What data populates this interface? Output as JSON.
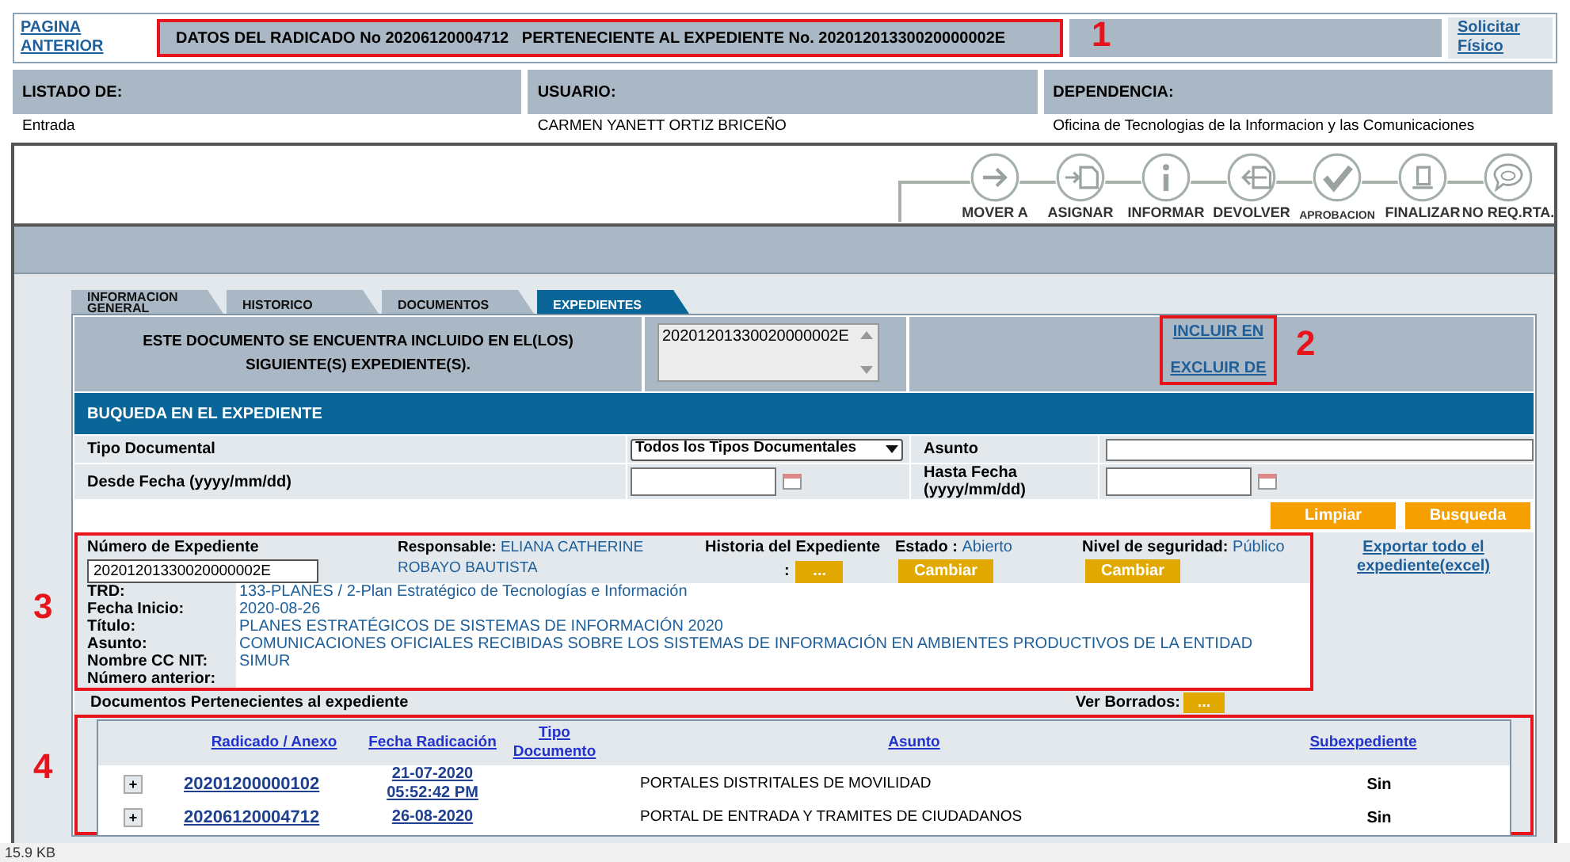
{
  "header": {
    "back_link": "PAGINA ANTERIOR",
    "title": "DATOS DEL RADICADO No 20206120004712   PERTENECIENTE AL EXPEDIENTE No. 20201201330020000002E",
    "request_link": "Solicitar Físico"
  },
  "info_columns": [
    {
      "heading": "LISTADO DE:",
      "value": "Entrada"
    },
    {
      "heading": "USUARIO:",
      "value": "CARMEN YANETT ORTIZ BRICEÑO"
    },
    {
      "heading": "DEPENDENCIA:",
      "value": "Oficina de Tecnologias de la Informacion y las Comunicaciones"
    }
  ],
  "actions": [
    {
      "kind": "move",
      "label": "MOVER A"
    },
    {
      "kind": "assign",
      "label": "ASIGNAR"
    },
    {
      "kind": "inform",
      "label": "INFORMAR"
    },
    {
      "kind": "return",
      "label": "DEVOLVER"
    },
    {
      "kind": "approve",
      "label": "APROBACION"
    },
    {
      "kind": "finalize",
      "label": "FINALIZAR"
    },
    {
      "kind": "noreply",
      "label": "NO REQ.RTA."
    }
  ],
  "tabs": [
    {
      "label": "INFORMACION GENERAL",
      "selected": false
    },
    {
      "label": "HISTORICO",
      "selected": false
    },
    {
      "label": "DOCUMENTOS",
      "selected": false
    },
    {
      "label": "EXPEDIENTES",
      "selected": true
    }
  ],
  "included": {
    "text": "ESTE DOCUMENTO SE ENCUENTRA INCLUIDO EN EL(LOS) SIGUIENTE(S) EXPEDIENTE(S).",
    "list": [
      "20201201330020000002E"
    ],
    "links": [
      "INCLUIR EN",
      "EXCLUIR DE"
    ]
  },
  "search": {
    "title": "BUQUEDA EN EL EXPEDIENTE",
    "type_label": "Tipo Documental",
    "type_value": "Todos los Tipos Documentales",
    "subject_label": "Asunto",
    "from_label": "Desde Fecha (yyyy/mm/dd)",
    "to_label": "Hasta Fecha (yyyy/mm/dd)",
    "buttons": [
      "Limpiar",
      "Busqueda"
    ]
  },
  "expediente": {
    "number_label": "Número de Expediente",
    "number_value": "20201201330020000002E",
    "responsible_label": "Responsable:",
    "responsible": "ELIANA CATHERINE ROBAYO BAUTISTA",
    "history_label": "Historia del Expediente",
    "history_colon": ":",
    "history_button": "...",
    "state_label": "Estado :",
    "state": "Abierto",
    "state_button": "Cambiar",
    "security_label": "Nivel de seguridad:",
    "security": "Público",
    "security_button": "Cambiar",
    "export_link": "Exportar todo el expediente(excel)",
    "details": [
      {
        "label": "TRD:",
        "value": "133-PLANES / 2-Plan Estratégico de Tecnologías e Información"
      },
      {
        "label": "Fecha Inicio:",
        "value": "2020-08-26"
      },
      {
        "label": "Título:",
        "value": "PLANES ESTRATÉGICOS DE SISTEMAS DE INFORMACIÓN 2020"
      },
      {
        "label": "Asunto:",
        "value": "COMUNICACIONES OFICIALES RECIBIDAS SOBRE LOS SISTEMAS DE INFORMACIÓN EN AMBIENTES PRODUCTIVOS DE LA ENTIDAD"
      },
      {
        "label": "Nombre CC NIT:",
        "value": "SIMUR"
      },
      {
        "label": "Número anterior:"
      }
    ]
  },
  "documents": {
    "title": "Documentos Pertenecientes al expediente",
    "deleted_label": "Ver Borrados:",
    "deleted_button": "...",
    "columns": [
      "Radicado / Anexo",
      "Fecha Radicación",
      "Tipo Documento",
      "Asunto",
      "Subexpediente"
    ],
    "rows": [
      {
        "expand": "+",
        "radicado": "20201200000102",
        "date": "21-07-2020",
        "time": "05:52:42 PM",
        "subject": "PORTALES DISTRITALES DE MOVILIDAD",
        "subexpediente": "Sin"
      },
      {
        "expand": "+",
        "radicado": "20206120004712",
        "date": "26-08-2020",
        "subject": "PORTAL DE ENTRADA Y TRAMITES DE CIUDADANOS",
        "subexpediente": "Sin"
      }
    ]
  },
  "annotations": [
    {
      "label": "1"
    },
    {
      "label": "2"
    },
    {
      "label": "3"
    },
    {
      "label": "4"
    }
  ],
  "status_bar": {
    "size": "15.9 KB"
  }
}
